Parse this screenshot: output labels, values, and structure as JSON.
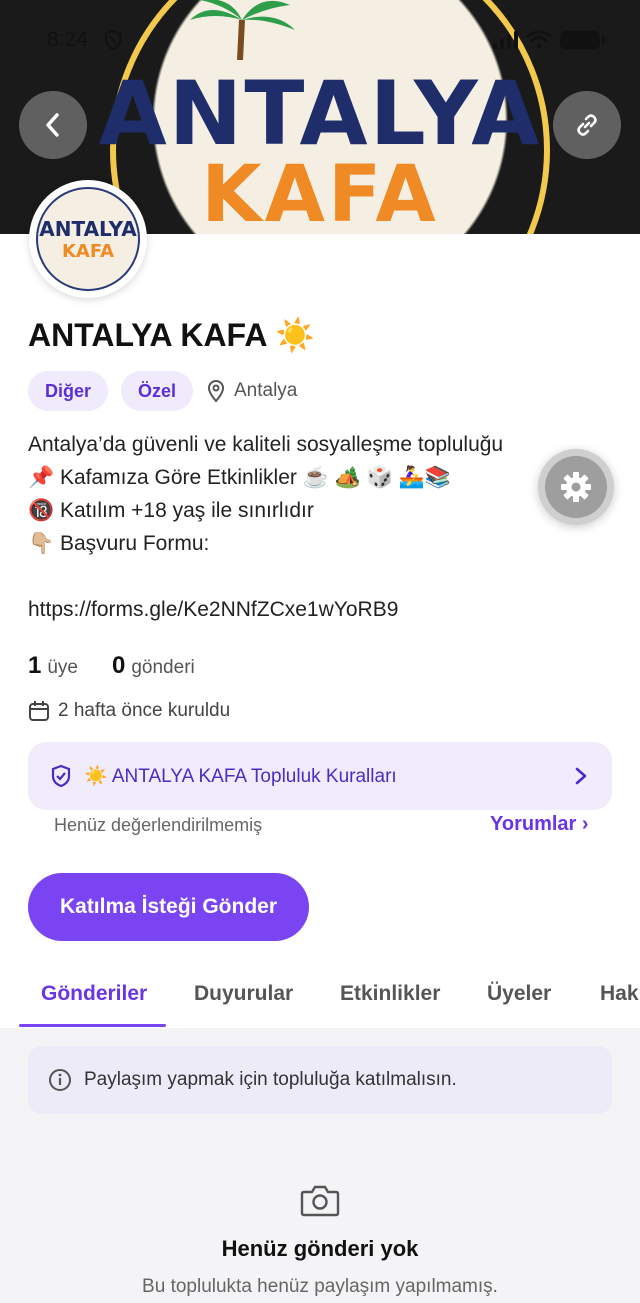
{
  "status_bar": {
    "time": "8:24"
  },
  "banner": {
    "line1": "ANTALYA",
    "line2": "KAFA"
  },
  "avatar": {
    "line1": "ANTALYA",
    "line2": "KAFA"
  },
  "community": {
    "title": "ANTALYA KAFA ☀️",
    "chips": [
      "Diğer",
      "Özel"
    ],
    "location": "Antalya",
    "description": "Antalya’da güvenli ve kaliteli sosyalleşme topluluğu\n📌 Kafamıza Göre Etkinlikler ☕ 🏕️ 🎲 🚣‍♀️📚\n🔞 Katılım +18 yaş ile sınırlıdır\n👇🏼 Başvuru Formu:\n\nhttps://forms.gle/Ke2NNfZCxe1wYoRB9",
    "member_count": "1",
    "member_label": "üye",
    "post_count": "0",
    "post_label": "gönderi",
    "founded": "2 hafta önce kuruldu"
  },
  "rules": {
    "label": "☀️ ANTALYA KAFA Topluluk Kuralları"
  },
  "rating": {
    "text": "Henüz değerlendirilmemiş",
    "comments_link": "Yorumlar ›"
  },
  "join_button": "Katılma İsteği Gönder",
  "tabs": [
    "Gönderiler",
    "Duyurular",
    "Etkinlikler",
    "Üyeler",
    "Hakkında"
  ],
  "notice": "Paylaşım yapmak için topluluğa katılmalısın.",
  "empty_state": {
    "title": "Henüz gönderi yok",
    "subtitle": "Bu toplulukta henüz paylaşım yapılmamış."
  },
  "colors": {
    "accent": "#7a44f2",
    "chip_bg": "#efeafc",
    "feed_bg": "#f4f4f6"
  }
}
